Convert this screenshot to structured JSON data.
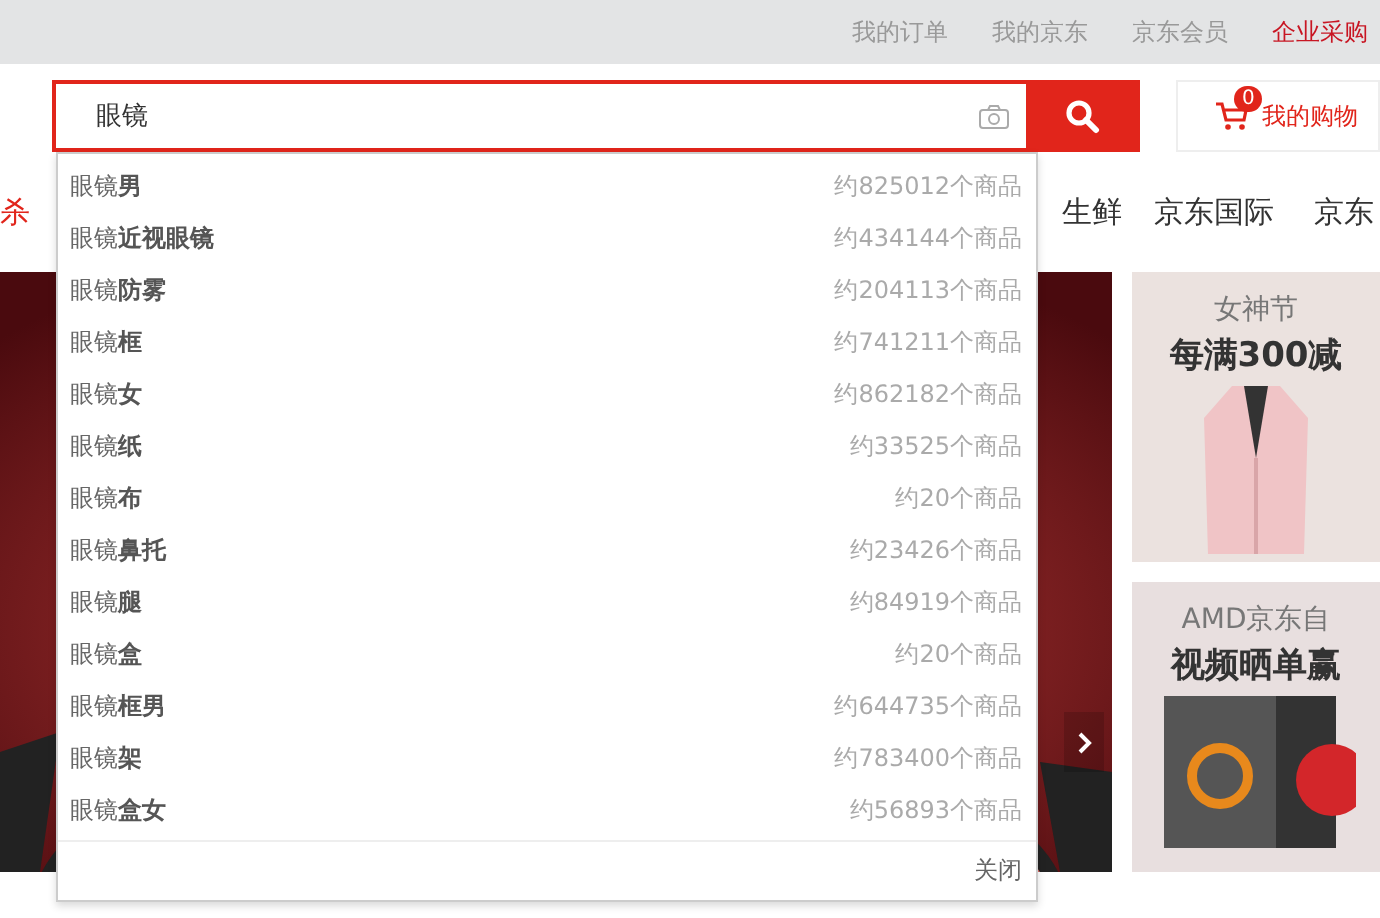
{
  "top_bar": {
    "links": [
      "我的订单",
      "我的京东",
      "京东会员",
      "企业采购"
    ]
  },
  "search": {
    "value": "眼镜"
  },
  "cart": {
    "count": "0",
    "label": "我的购物"
  },
  "nav": {
    "items": [
      {
        "label": "杀",
        "kind": "accent"
      },
      {
        "label": "生鲜",
        "kind": "plain"
      },
      {
        "label": "京东国际",
        "kind": "plain"
      },
      {
        "label": "京东",
        "kind": "plain"
      }
    ]
  },
  "suggestions": [
    {
      "text": "眼镜**男**",
      "count": "约825012个商品"
    },
    {
      "text": "眼镜**近视眼镜**",
      "count": "约434144个商品"
    },
    {
      "text": "眼镜**防雾**",
      "count": "约204113个商品"
    },
    {
      "text": "眼镜**框**",
      "count": "约741211个商品"
    },
    {
      "text": "眼镜**女**",
      "count": "约862182个商品"
    },
    {
      "text": "眼镜**纸**",
      "count": "约33525个商品"
    },
    {
      "text": "眼镜**布**",
      "count": "约20个商品"
    },
    {
      "text": "眼镜**鼻托**",
      "count": "约23426个商品"
    },
    {
      "text": "眼镜**腿**",
      "count": "约84919个商品"
    },
    {
      "text": "眼镜**盒**",
      "count": "约20个商品"
    },
    {
      "text": "眼镜**框男**",
      "count": "约644735个商品"
    },
    {
      "text": "眼镜**架**",
      "count": "约783400个商品"
    },
    {
      "text": "眼镜**盒女**",
      "count": "约56893个商品"
    }
  ],
  "close_label": "关闭",
  "promos": [
    {
      "title": "女神节",
      "headline": "每满300减",
      "kind": "jacket"
    },
    {
      "title": "AMD京东自",
      "headline": "视频晒单赢",
      "kind": "box"
    }
  ]
}
